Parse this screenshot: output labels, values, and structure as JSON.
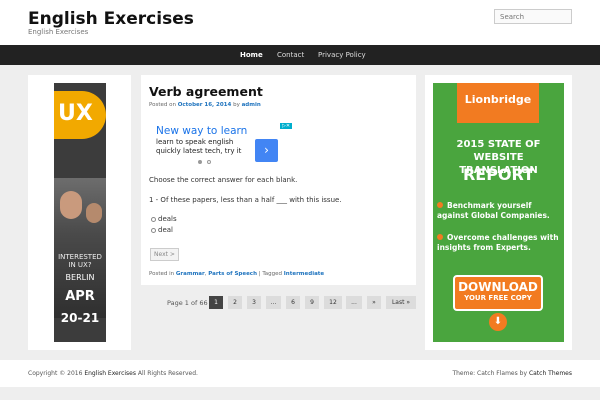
{
  "header": {
    "site_title": "English Exercises",
    "site_description": "English Exercises",
    "search_placeholder": "Search"
  },
  "nav": {
    "items": [
      {
        "label": "Home",
        "active": true
      },
      {
        "label": "Contact",
        "active": false
      },
      {
        "label": "Privacy Policy",
        "active": false
      }
    ]
  },
  "left_ad": {
    "logo_text": "UX",
    "question": "INTERESTED IN UX?",
    "city": "BERLIN",
    "month": "APR",
    "days": "20-21"
  },
  "right_ad": {
    "logo": "Lionbridge",
    "headline": "2015 STATE OF WEBSITE TRANSLATION",
    "headline_big": "REPORT",
    "point1": "Benchmark yourself against Global Companies.",
    "point2": "Overcome challenges with insights from Experts.",
    "cta_main": "DOWNLOAD",
    "cta_sub": "YOUR FREE COPY"
  },
  "post": {
    "title": "Verb agreement",
    "meta_prefix": "Posted on",
    "date": "October 16, 2014",
    "by": "by",
    "author": "admin",
    "instruction": "Choose the correct answer for each blank.",
    "question": "1 - Of these papers, less than a half ___ with this issue.",
    "options": [
      "deals",
      "deal"
    ],
    "next_label": "Next >",
    "posted_in_label": "Posted in",
    "category1": "Grammar",
    "category2": "Parts of Speech",
    "tagged_label": "| Tagged",
    "tag": "Intermediate"
  },
  "inner_ad": {
    "headline": "New way to learn",
    "body": "learn to speak english quickly latest tech, try it",
    "button_icon": "chevron-right-icon"
  },
  "pagination": {
    "label": "Page 1 of 66",
    "pages": [
      "1",
      "2",
      "3",
      "...",
      "6",
      "9",
      "12",
      "...",
      "»",
      "Last »"
    ],
    "current": "1"
  },
  "footer": {
    "copyright_prefix": "Copyright © 2016",
    "site_name": "English Exercises",
    "rights": "All Rights Reserved.",
    "theme_prefix": "Theme: Catch Flames by",
    "theme_author": "Catch Themes"
  }
}
